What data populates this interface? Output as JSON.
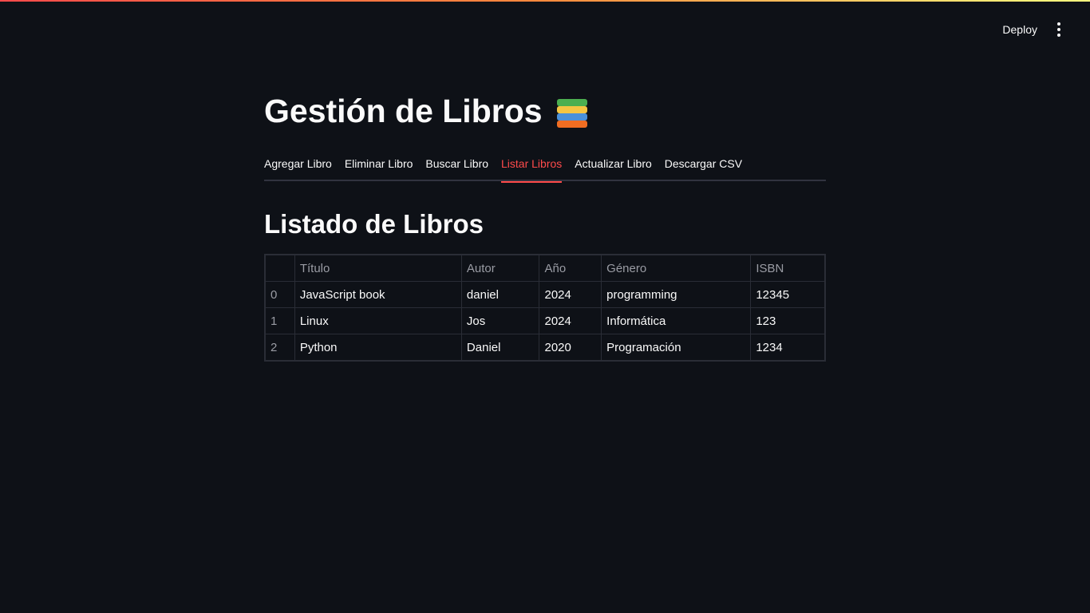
{
  "header": {
    "deploy_label": "Deploy"
  },
  "page": {
    "title": "Gestión de Libros",
    "title_icon": "books-emoji-icon"
  },
  "tabs": [
    {
      "label": "Agregar Libro",
      "active": false
    },
    {
      "label": "Eliminar Libro",
      "active": false
    },
    {
      "label": "Buscar Libro",
      "active": false
    },
    {
      "label": "Listar Libros",
      "active": true
    },
    {
      "label": "Actualizar Libro",
      "active": false
    },
    {
      "label": "Descargar CSV",
      "active": false
    }
  ],
  "section": {
    "title": "Listado de Libros"
  },
  "table": {
    "columns": [
      "",
      "Título",
      "Autor",
      "Año",
      "Género",
      "ISBN"
    ],
    "rows": [
      [
        "0",
        "JavaScript book",
        "daniel",
        "2024",
        "programming",
        "12345"
      ],
      [
        "1",
        "Linux",
        "Jos",
        "2024",
        "Informática",
        "123"
      ],
      [
        "2",
        "Python",
        "Daniel",
        "2020",
        "Programación",
        "1234"
      ]
    ]
  },
  "colors": {
    "background": "#0e1117",
    "accent": "#ff4b4b",
    "text": "#fafafa",
    "muted": "#9a9ca4",
    "border": "#2a2d36"
  }
}
